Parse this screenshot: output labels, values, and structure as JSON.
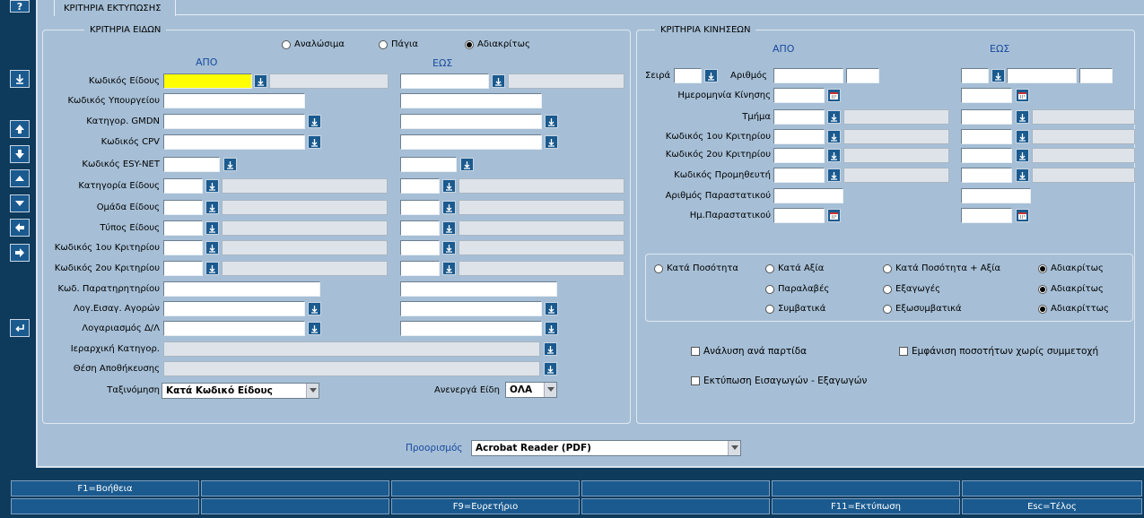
{
  "toolbar": {
    "help": "?",
    "icons": [
      "help-icon",
      "download-icon",
      "first-record-icon",
      "last-record-icon",
      "prev-record-icon",
      "next-record-icon",
      "prev-block-icon",
      "next-block-icon",
      "return-icon"
    ]
  },
  "tab": {
    "title": "ΚΡΙΤΗΡΙΑ ΕΚΤΥΠΩΣΗΣ"
  },
  "items": {
    "title": "ΚΡΙΤΗΡΙΑ ΕΙΔΩΝ",
    "type_radios": [
      {
        "label": "Αναλώσιμα",
        "checked": false
      },
      {
        "label": "Πάγια",
        "checked": false
      },
      {
        "label": "Αδιακρίτως",
        "checked": true
      }
    ],
    "from_header": "ΑΠΟ",
    "to_header": "ΕΩΣ",
    "labels": {
      "item_code": "Κωδικός Είδους",
      "ministry_code": "Κωδικός Υπουργείου",
      "gmdn": "Κατηγορ. GMDN",
      "cpv": "Κωδικός CPV",
      "esynet": "Κωδικός ESY-NET",
      "category": "Κατηγορία Είδους",
      "group": "Ομάδα Είδους",
      "type": "Τύπος Είδους",
      "crit1": "Κωδικός 1ου Κριτηρίου",
      "crit2": "Κωδικός 2ου Κριτηρίου",
      "observatory": "Κωδ. Παρατηρητηρίου",
      "purchase_account": "Λογ.Εισαγ. Αγορών",
      "account_dl": "Λογαριασμός Δ/Λ",
      "hierarchy": "Ιεραρχική Κατηγορ.",
      "storage": "Θέση Αποθήκευσης",
      "sort": "Ταξινόμηση",
      "inactive": "Ανενεργά Είδη"
    },
    "sort_value": "Κατά Κωδικό Είδους",
    "inactive_value": "ΟΛΑ"
  },
  "movements": {
    "title": "ΚΡΙΤΗΡΙΑ ΚΙΝΗΣΕΩΝ",
    "from_header": "ΑΠΟ",
    "to_header": "ΕΩΣ",
    "labels": {
      "series": "Σειρά",
      "number": "Αριθμός",
      "date": "Ημερομηνία Κίνησης",
      "department": "Τμήμα",
      "crit1": "Κωδικός 1ου Κριτηρίου",
      "crit2": "Κωδικός 2ου Κριτηρίου",
      "supplier": "Κωδικός Προμηθευτή",
      "doc_number": "Αριθμός Παραστατικού",
      "doc_date": "Ημ.Παραστατικού"
    },
    "radio_rows": [
      [
        {
          "label": "Κατά Ποσότητα",
          "checked": false
        },
        {
          "label": "Κατά Αξία",
          "checked": false
        },
        {
          "label": "Κατά Ποσότητα + Αξία",
          "checked": false
        },
        {
          "label": "Αδιακρίτως",
          "checked": true
        }
      ],
      [
        {
          "label": "Παραλαβές",
          "checked": false
        },
        {
          "label": "Εξαγωγές",
          "checked": false
        },
        {
          "label": "Αδιακρίτως",
          "checked": true
        }
      ],
      [
        {
          "label": "Συμβατικά",
          "checked": false
        },
        {
          "label": "Εξωσυμβατικά",
          "checked": false
        },
        {
          "label": "Αδιακρίττως",
          "checked": true
        }
      ]
    ],
    "checkboxes": {
      "batch_analysis": "Ανάλυση ανά παρτίδα",
      "show_no_participation": "Εμφάνιση ποσοτήτων χωρίς συμμετοχή",
      "print_imports_exports": "Εκτύπωση Εισαγωγών - Εξαγωγών"
    }
  },
  "destination": {
    "label": "Προορισμός",
    "value": "Acrobat Reader (PDF)"
  },
  "fkeys": {
    "row1": [
      "F1=Βοήθεια",
      "",
      "",
      "",
      "",
      ""
    ],
    "row2": [
      "",
      "",
      "F9=Ευρετήριο",
      "",
      "F11=Εκτύπωση",
      "Esc=Τέλος"
    ]
  },
  "colors": {
    "accent": "#1a5a8f",
    "panel": "#a6bfd6",
    "frame": "#0e3a5c",
    "highlight": "#ffff00",
    "header_text": "#1a4aa0"
  }
}
